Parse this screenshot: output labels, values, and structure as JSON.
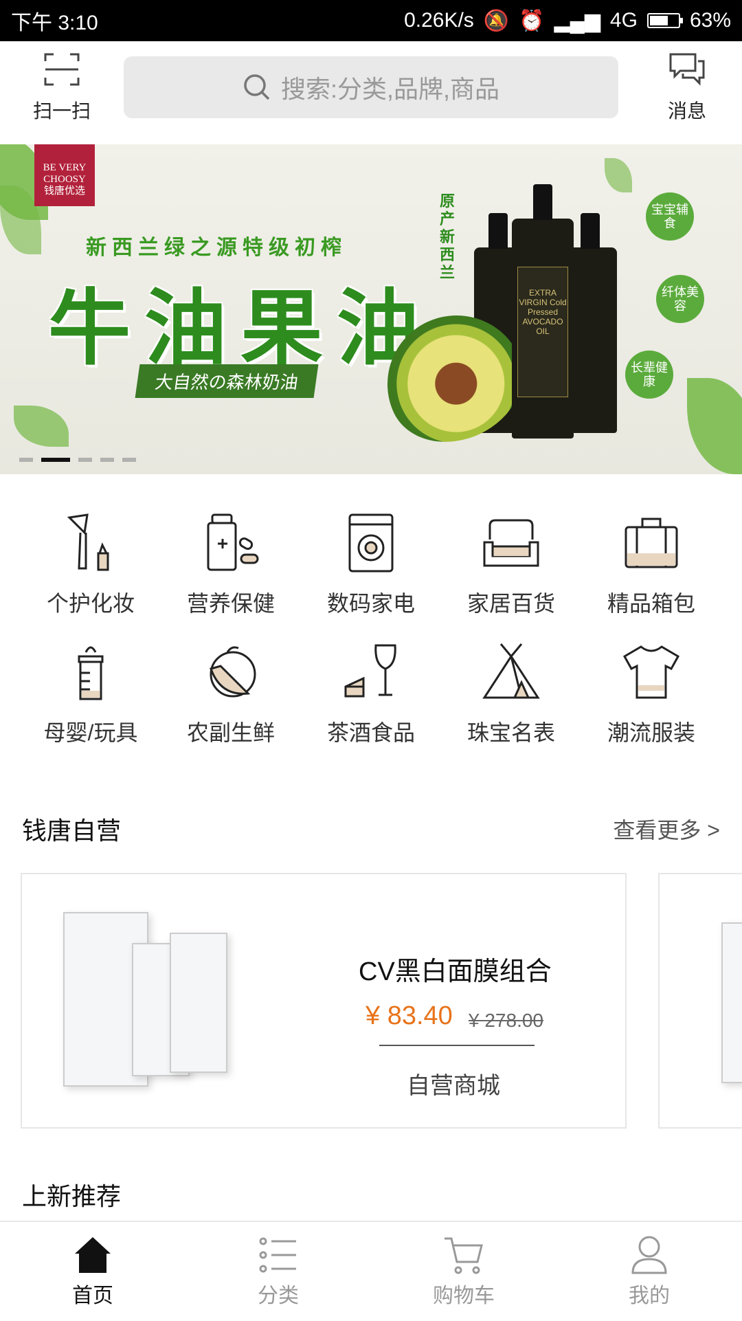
{
  "status_bar": {
    "time": "下午 3:10",
    "net_speed": "0.26K/s",
    "network": "4G",
    "battery": "63%"
  },
  "top_bar": {
    "scan_label": "扫一扫",
    "search_placeholder": "搜索:分类,品牌,商品",
    "message_label": "消息"
  },
  "banner": {
    "brand_line1": "BE VERY",
    "brand_line2": "CHOOSY",
    "brand_cn": "钱唐优选",
    "subtitle": "新西兰绿之源特级初榨",
    "title": "牛油果油",
    "slogan": "大自然の森林奶油",
    "origin": "原产新西兰",
    "bottle_label": "EXTRA VIRGIN Cold Pressed AVOCADO OIL",
    "badges": [
      "宝宝辅食",
      "纤体美容",
      "长辈健康"
    ],
    "slide_count": 5,
    "active_slide": 2
  },
  "categories": [
    {
      "label": "个护化妆",
      "icon": "makeup-brush-icon"
    },
    {
      "label": "营养保健",
      "icon": "medicine-bottle-icon"
    },
    {
      "label": "数码家电",
      "icon": "washing-machine-icon"
    },
    {
      "label": "家居百货",
      "icon": "sofa-icon"
    },
    {
      "label": "精品箱包",
      "icon": "luggage-icon"
    },
    {
      "label": "母婴/玩具",
      "icon": "baby-bottle-icon"
    },
    {
      "label": "农副生鲜",
      "icon": "fruit-icon"
    },
    {
      "label": "茶酒食品",
      "icon": "wine-cake-icon"
    },
    {
      "label": "珠宝名表",
      "icon": "tent-icon"
    },
    {
      "label": "潮流服装",
      "icon": "tshirt-icon"
    }
  ],
  "self_run": {
    "title": "钱唐自营",
    "more": "查看更多 >",
    "products": [
      {
        "name": "CV黑白面膜组合",
        "price": "¥ 83.40",
        "original_price": "¥ 278.00",
        "shop": "自营商城"
      }
    ]
  },
  "new_arrivals": {
    "title": "上新推荐"
  },
  "bottom_nav": [
    {
      "label": "首页",
      "icon": "home-icon",
      "active": true
    },
    {
      "label": "分类",
      "icon": "list-icon",
      "active": false
    },
    {
      "label": "购物车",
      "icon": "cart-icon",
      "active": false
    },
    {
      "label": "我的",
      "icon": "user-icon",
      "active": false
    }
  ],
  "colors": {
    "accent_price": "#e8731a",
    "banner_green": "#2d8c1d",
    "brand_red": "#b2213b"
  }
}
